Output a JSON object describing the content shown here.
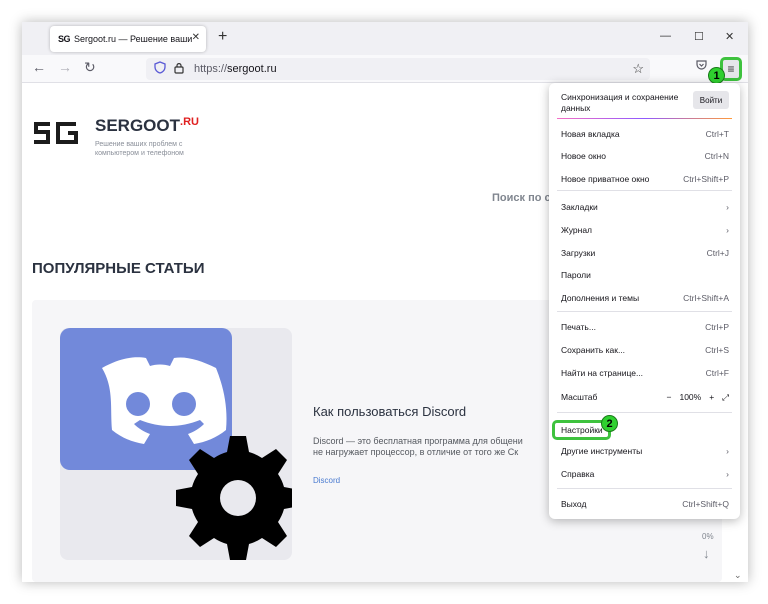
{
  "browser": {
    "tab_title": "Sergoot.ru — Решение ваших п",
    "tab_favicon": "SG",
    "url_scheme": "https://",
    "url_host": "sergoot.ru"
  },
  "page": {
    "site_name": "SERGOOT",
    "site_tld": ".RU",
    "tagline": "Решение ваших проблем с компьютером и телефоном",
    "search_hint": "Поиск по с",
    "section_title": "ПОПУЛЯРНЫЕ СТАТЬИ",
    "article": {
      "title": "Как пользоваться Discord",
      "desc_line1": "Discord — это бесплатная программа для общени",
      "desc_line2": "не нагружает процессор, в отличие от того же Ск",
      "tag": "Discord"
    },
    "scroll_percent": "0%"
  },
  "menu": {
    "sync_text": "Синхронизация и сохранение данных",
    "signin_label": "Войти",
    "items": [
      {
        "label": "Новая вкладка",
        "shortcut": "Ctrl+T"
      },
      {
        "label": "Новое окно",
        "shortcut": "Ctrl+N"
      },
      {
        "label": "Новое приватное окно",
        "shortcut": "Ctrl+Shift+P"
      },
      {
        "label": "Закладки",
        "shortcut": "›"
      },
      {
        "label": "Журнал",
        "shortcut": "›"
      },
      {
        "label": "Загрузки",
        "shortcut": "Ctrl+J"
      },
      {
        "label": "Пароли",
        "shortcut": ""
      },
      {
        "label": "Дополнения и темы",
        "shortcut": "Ctrl+Shift+A"
      },
      {
        "label": "Печать...",
        "shortcut": "Ctrl+P"
      },
      {
        "label": "Сохранить как...",
        "shortcut": "Ctrl+S"
      },
      {
        "label": "Найти на странице...",
        "shortcut": "Ctrl+F"
      },
      {
        "label": "Масштаб",
        "shortcut": ""
      },
      {
        "label": "Настройки",
        "shortcut": ""
      },
      {
        "label": "Другие инструменты",
        "shortcut": "›"
      },
      {
        "label": "Справка",
        "shortcut": "›"
      },
      {
        "label": "Выход",
        "shortcut": "Ctrl+Shift+Q"
      }
    ],
    "zoom_minus": "−",
    "zoom_value": "100%",
    "zoom_plus": "+",
    "zoom_fullscreen": "⤢"
  },
  "annotations": {
    "step1": "1",
    "step2": "2",
    "highlight_color": "#3ec23e"
  }
}
